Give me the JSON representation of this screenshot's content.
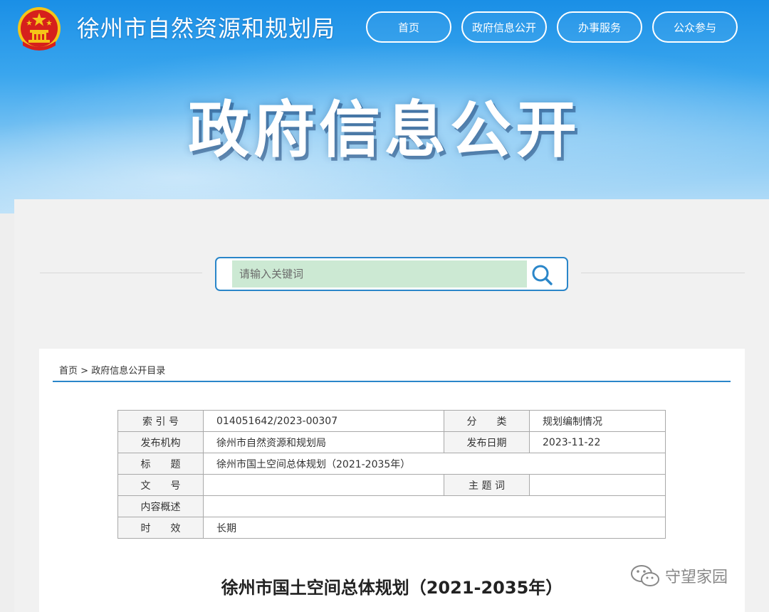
{
  "header": {
    "site_title": "徐州市自然资源和规划局",
    "nav": [
      "首页",
      "政府信息公开",
      "办事服务",
      "公众参与"
    ],
    "hero": "政府信息公开"
  },
  "search": {
    "placeholder": "请输入关键词",
    "value": ""
  },
  "breadcrumb": {
    "home": "首页",
    "separator": " > ",
    "current": "政府信息公开目录"
  },
  "meta": {
    "index_label": "索 引 号",
    "index_value": "014051642/2023-00307",
    "category_label": "分　　类",
    "category_value": "规划编制情况",
    "publisher_label": "发布机构",
    "publisher_value": "徐州市自然资源和规划局",
    "date_label": "发布日期",
    "date_value": "2023-11-22",
    "title_label": "标　　题",
    "title_value": "徐州市国土空间总体规划（2021-2035年）",
    "docno_label": "文　　号",
    "docno_value": "",
    "keywords_label": "主 题 词",
    "keywords_value": "",
    "summary_label": "内容概述",
    "summary_value": "",
    "validity_label": "时　　效",
    "validity_value": "长期"
  },
  "document": {
    "title": "徐州市国土空间总体规划（2021-2035年）"
  },
  "watermark": {
    "text": "守望家园"
  },
  "colors": {
    "accent": "#2a86c9",
    "search_fill": "#cce9d3",
    "emblem_red": "#d6201c",
    "emblem_gold": "#f5c518"
  }
}
